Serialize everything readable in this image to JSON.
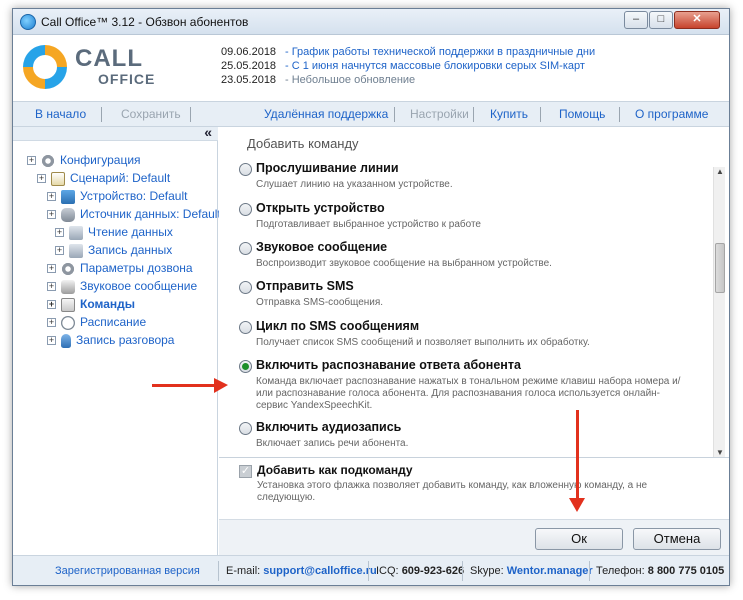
{
  "window": {
    "title": "Call Office™ 3.12 - Обзвон абонентов",
    "min": "–",
    "max": "□",
    "close": "✕"
  },
  "logo": {
    "line1": "CALL",
    "line2": "OFFICE"
  },
  "news": [
    {
      "date": "09.06.2018",
      "text": "- График работы технической поддержки в праздничные дни"
    },
    {
      "date": "25.05.2018",
      "text": "- С 1 июня начнутся массовые блокировки серых SIM-карт"
    },
    {
      "date": "23.05.2018",
      "text": "- Небольшое обновление"
    }
  ],
  "toolbar": {
    "home": "В начало",
    "save": "Сохранить",
    "remote": "Удалённая поддержка",
    "settings": "Настройки",
    "buy": "Купить",
    "help": "Помощь",
    "about": "О программе"
  },
  "tree": {
    "collapse": "«",
    "items": [
      {
        "label": "Конфигурация",
        "icon": "gear-icon"
      },
      {
        "label": "Сценарий: Default",
        "icon": "document-icon"
      },
      {
        "label": "Устройство: Default",
        "icon": "device-icon"
      },
      {
        "label": "Источник данных: Default",
        "icon": "database-icon"
      },
      {
        "label": "Чтение данных",
        "icon": "data-read-icon"
      },
      {
        "label": "Запись данных",
        "icon": "data-write-icon"
      },
      {
        "label": "Параметры дозвона",
        "icon": "settings-icon"
      },
      {
        "label": "Звуковое сообщение",
        "icon": "speaker-icon"
      },
      {
        "label": "Команды",
        "icon": "commands-icon"
      },
      {
        "label": "Расписание",
        "icon": "clock-icon"
      },
      {
        "label": "Запись разговора",
        "icon": "microphone-icon"
      }
    ]
  },
  "panel": {
    "title": "Добавить команду",
    "options": [
      {
        "label": "Прослушивание линии",
        "desc": "Слушает линию на указанном устройстве.",
        "selected": false
      },
      {
        "label": "Открыть устройство",
        "desc": "Подготавливает выбранное устройство к работе",
        "selected": false
      },
      {
        "label": "Звуковое сообщение",
        "desc": "Воспроизводит звуковое сообщение на выбранном устройстве.",
        "selected": false
      },
      {
        "label": "Отправить SMS",
        "desc": "Отправка SMS-сообщения.",
        "selected": false
      },
      {
        "label": "Цикл по SMS сообщениям",
        "desc": "Получает список SMS сообщений и позволяет выполнить их обработку.",
        "selected": false
      },
      {
        "label": "Включить распознавание ответа абонента",
        "desc": "Команда включает распознавание нажатых в тональном режиме клавиш набора номера и/или распознавание голоса абонента. Для распознавания голоса используется онлайн-сервис YandexSpeechKit.",
        "selected": true
      },
      {
        "label": "Включить аудиозапись",
        "desc": "Включает запись речи абонента.",
        "selected": false
      }
    ],
    "subcommand": {
      "checked": true,
      "mark": "✓",
      "label": "Добавить как подкоманду",
      "desc": "Установка этого флажка позволяет добавить команду, как вложенную команду, а не следующую."
    },
    "ok": "Ок",
    "cancel": "Отмена"
  },
  "status": {
    "registered": "Зарегистрированная версия",
    "email_label": "E-mail:",
    "email": "support@calloffice.ru",
    "icq_label": "ICQ:",
    "icq": "609-923-626",
    "skype_label": "Skype:",
    "skype": "Wentor.manager",
    "phone_label": "Телефон:",
    "phone": "8 800 775 0105"
  },
  "colors": {
    "accent": "#1e63c8",
    "arrow": "#e2311d",
    "radio_selected": "#1c8f2a"
  }
}
